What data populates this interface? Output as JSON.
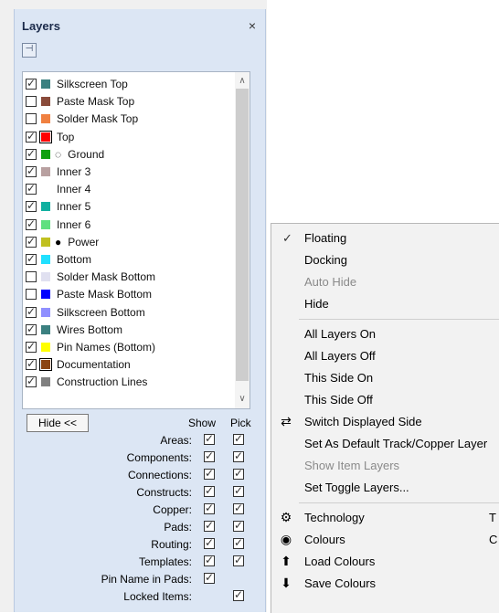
{
  "panel": {
    "title": "Layers",
    "close": "×",
    "pin_icon": "⊣",
    "layers": [
      {
        "checked": true,
        "color": "#3b8080",
        "name": "Silkscreen Top"
      },
      {
        "checked": false,
        "color": "#8a4b3a",
        "name": "Paste Mask Top"
      },
      {
        "checked": false,
        "color": "#f08040",
        "name": "Solder Mask Top"
      },
      {
        "checked": true,
        "color": "#ff0000",
        "name": "Top",
        "framed": true
      },
      {
        "checked": true,
        "color": "#10a010",
        "name": "Ground",
        "glyph": "◌"
      },
      {
        "checked": true,
        "color": "#b8a0a0",
        "name": "Inner 3"
      },
      {
        "checked": true,
        "color": "#ffffff",
        "name": "Inner 4"
      },
      {
        "checked": true,
        "color": "#10b0a0",
        "name": "Inner 5"
      },
      {
        "checked": true,
        "color": "#60e080",
        "name": "Inner 6"
      },
      {
        "checked": true,
        "color": "#c0c020",
        "name": "Power",
        "glyph": "●"
      },
      {
        "checked": true,
        "color": "#20e0ff",
        "name": "Bottom"
      },
      {
        "checked": false,
        "color": "#e0e0f0",
        "name": "Solder Mask Bottom"
      },
      {
        "checked": false,
        "color": "#0000ff",
        "name": "Paste Mask Bottom"
      },
      {
        "checked": true,
        "color": "#9090ff",
        "name": "Silkscreen Bottom"
      },
      {
        "checked": true,
        "color": "#3b8080",
        "name": "Wires Bottom"
      },
      {
        "checked": true,
        "color": "#ffff00",
        "name": "Pin Names (Bottom)"
      },
      {
        "checked": true,
        "color": "#8b4513",
        "name": "Documentation",
        "framed": true
      },
      {
        "checked": true,
        "color": "#808080",
        "name": "Construction Lines"
      }
    ],
    "hide_button": "Hide <<",
    "show_header": "Show",
    "pick_header": "Pick",
    "options": [
      {
        "label": "Areas:",
        "show": true,
        "pick": true
      },
      {
        "label": "Components:",
        "show": true,
        "pick": true
      },
      {
        "label": "Connections:",
        "show": true,
        "pick": true
      },
      {
        "label": "Constructs:",
        "show": true,
        "pick": true
      },
      {
        "label": "Copper:",
        "show": true,
        "pick": true
      },
      {
        "label": "Pads:",
        "show": true,
        "pick": true
      },
      {
        "label": "Routing:",
        "show": true,
        "pick": true
      },
      {
        "label": "Templates:",
        "show": true,
        "pick": true
      },
      {
        "label": "Pin Name in Pads:",
        "show": true,
        "pick": null
      },
      {
        "label": "Locked Items:",
        "show": null,
        "pick": true
      }
    ]
  },
  "menu": {
    "items": [
      {
        "label": "Floating",
        "checked": true
      },
      {
        "label": "Docking"
      },
      {
        "label": "Auto Hide",
        "disabled": true
      },
      {
        "label": "Hide"
      },
      {
        "sep": true
      },
      {
        "label": "All Layers On"
      },
      {
        "label": "All Layers Off"
      },
      {
        "label": "This Side On"
      },
      {
        "label": "This Side Off"
      },
      {
        "label": "Switch Displayed Side",
        "icon": "switch-side-icon",
        "glyph": "⇄"
      },
      {
        "label": "Set As Default Track/Copper Layer"
      },
      {
        "label": "Show Item Layers",
        "disabled": true
      },
      {
        "label": "Set Toggle Layers..."
      },
      {
        "sep": true
      },
      {
        "label": "Technology",
        "icon": "technology-icon",
        "glyph": "⚙",
        "shortcut": "T"
      },
      {
        "label": "Colours",
        "icon": "colours-icon",
        "glyph": "◉",
        "shortcut": "C"
      },
      {
        "label": "Load Colours",
        "icon": "load-colours-icon",
        "glyph": "⬆"
      },
      {
        "label": "Save Colours",
        "icon": "save-colours-icon",
        "glyph": "⬇"
      }
    ]
  }
}
